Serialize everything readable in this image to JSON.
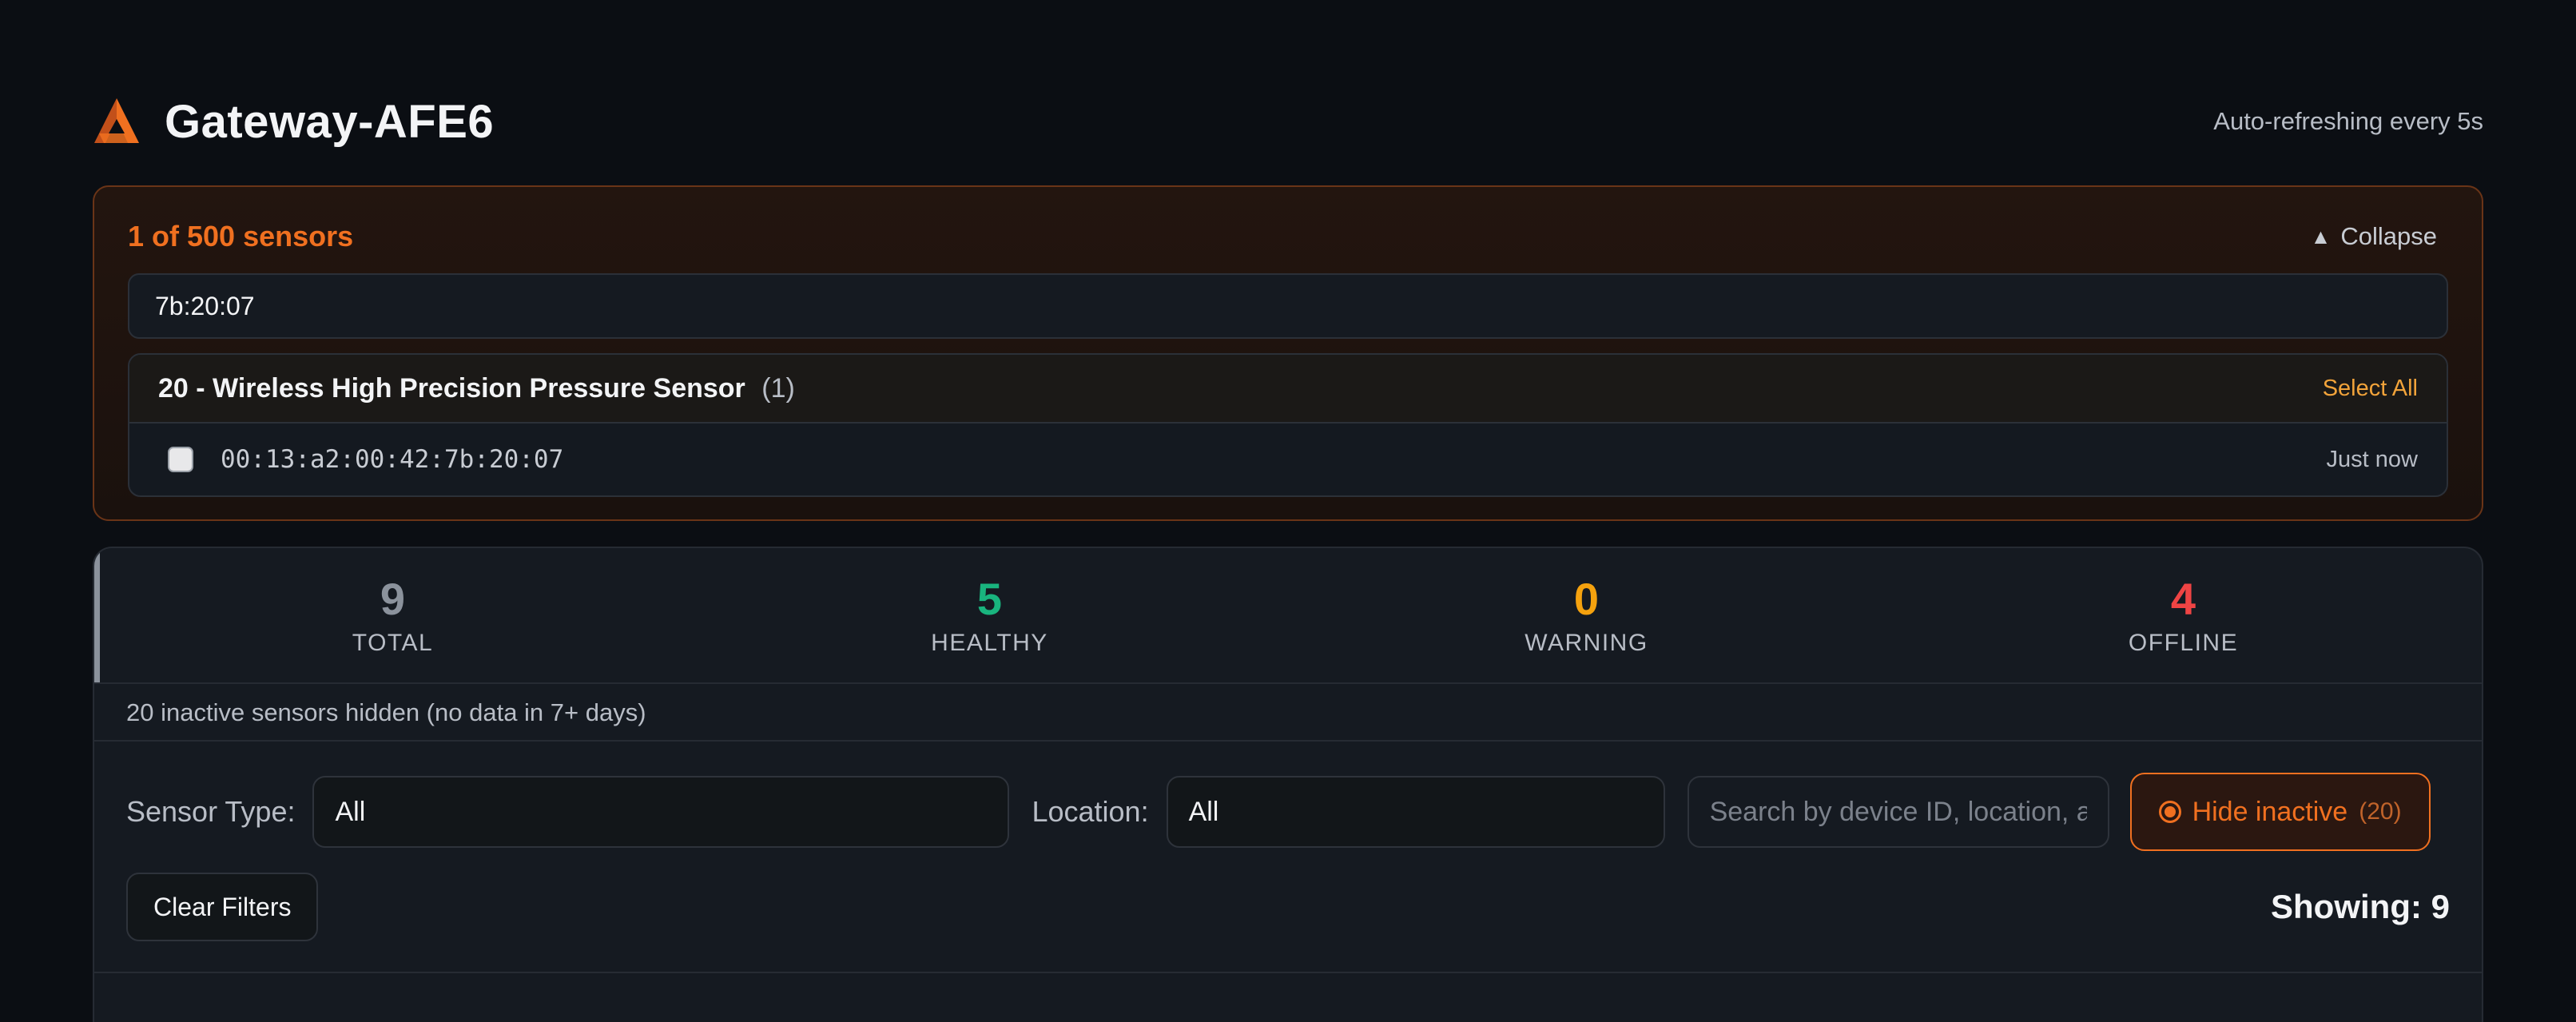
{
  "header": {
    "title": "Gateway-AFE6",
    "refresh_text": "Auto-refreshing every 5s",
    "logo_icon": "gateway-logo-icon"
  },
  "selection": {
    "count_text": "1 of 500 sensors",
    "collapse_label": "Collapse",
    "collapse_icon": "caret-up-icon",
    "search_value": "7b:20:07",
    "group": {
      "title": "20 - Wireless High Precision Pressure Sensor",
      "count": "(1)",
      "select_all_label": "Select All",
      "rows": [
        {
          "mac": "00:13:a2:00:42:7b:20:07",
          "last_seen": "Just now",
          "checked": false
        }
      ]
    }
  },
  "stats": [
    {
      "value": "9",
      "label": "TOTAL",
      "color": "#8b929c"
    },
    {
      "value": "5",
      "label": "HEALTHY",
      "color": "#19b47e"
    },
    {
      "value": "0",
      "label": "WARNING",
      "color": "#f5a20e"
    },
    {
      "value": "4",
      "label": "OFFLINE",
      "color": "#ef4444"
    }
  ],
  "hidden_notice": "20 inactive sensors hidden (no data in 7+ days)",
  "filters": {
    "sensor_type_label": "Sensor Type:",
    "sensor_type_value": "All",
    "location_label": "Location:",
    "location_value": "All",
    "search_placeholder": "Search by device ID, location, asset",
    "hide_inactive_label": "Hide inactive",
    "hide_inactive_count": "(20)",
    "clear_label": "Clear Filters",
    "showing_text": "Showing: 9"
  }
}
